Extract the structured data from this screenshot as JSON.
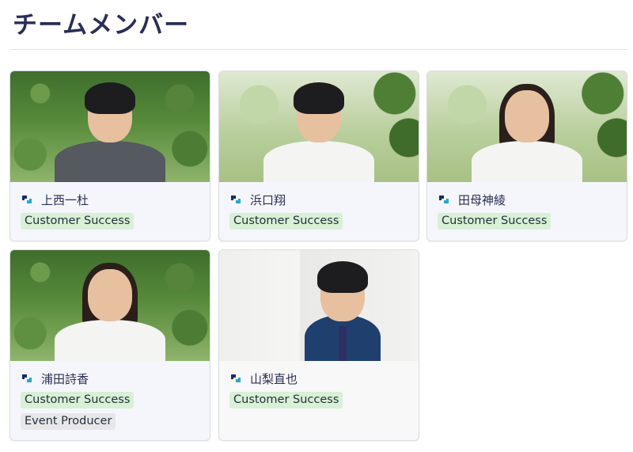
{
  "page": {
    "title": "チームメンバー"
  },
  "brand": {
    "icon": "brand-s-icon",
    "color_dark": "#1b2a6b",
    "color_light": "#2aa7c9"
  },
  "members": [
    {
      "name": "上西一杜",
      "tags": [
        "Customer Success"
      ]
    },
    {
      "name": "浜口翔",
      "tags": [
        "Customer Success"
      ]
    },
    {
      "name": "田母神綾",
      "tags": [
        "Customer Success"
      ]
    },
    {
      "name": "浦田詩香",
      "tags": [
        "Customer Success",
        "Event Producer"
      ]
    },
    {
      "name": "山梨直也",
      "tags": [
        "Customer Success"
      ]
    }
  ],
  "colors": {
    "tag_green": "#d8f0d5",
    "tag_gray": "#e7e7e9",
    "title": "#2a2d55"
  }
}
